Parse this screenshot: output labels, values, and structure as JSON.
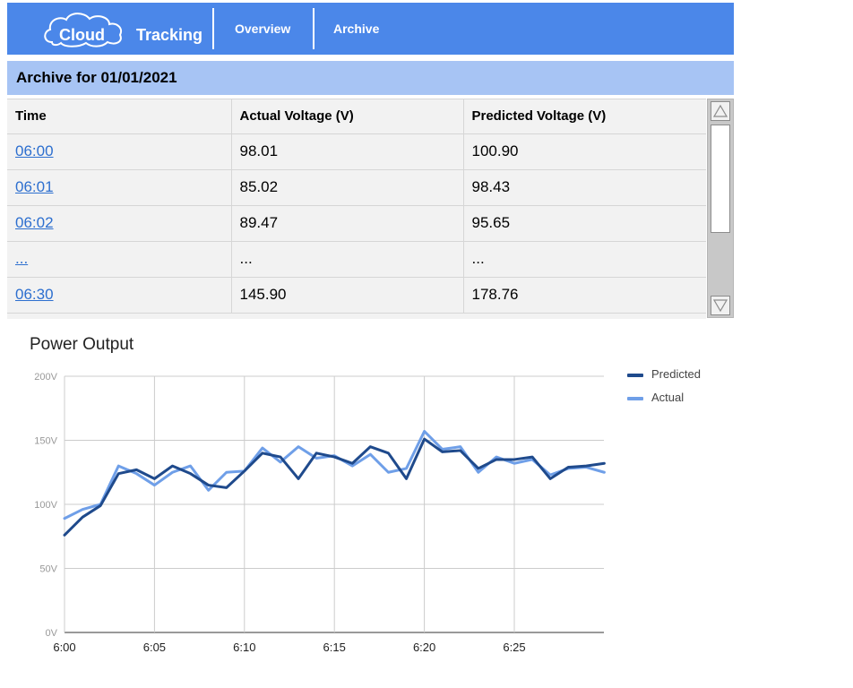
{
  "nav": {
    "logo_word_1": "Cloud",
    "logo_word_2": "Tracking",
    "links": [
      "Overview",
      "Archive"
    ]
  },
  "archive": {
    "title": "Archive for 01/01/2021"
  },
  "table": {
    "headers": [
      "Time",
      "Actual Voltage (V)",
      "Predicted Voltage (V)"
    ],
    "rows": [
      [
        "06:00",
        "98.01",
        "100.90"
      ],
      [
        "06:01",
        "85.02",
        "98.43"
      ],
      [
        "06:02",
        "89.47",
        "95.65"
      ],
      [
        "...",
        "...",
        "..."
      ],
      [
        "06:30",
        "145.90",
        "178.76"
      ]
    ]
  },
  "colors": {
    "nav": "#4b87e9",
    "header": "#a7c4f4",
    "predicted": "#1f4a8c",
    "actual": "#6f9fe8",
    "link": "#2d6fcf"
  },
  "chart_data": {
    "type": "line",
    "title": "Power Output",
    "xlabel": "",
    "ylabel": "",
    "x_ticks": [
      "6:00",
      "6:05",
      "6:10",
      "6:15",
      "6:20",
      "6:25"
    ],
    "y_ticks": [
      "0V",
      "50V",
      "100V",
      "150V",
      "200V"
    ],
    "ylim": [
      0,
      200
    ],
    "x": [
      0,
      1,
      2,
      3,
      4,
      5,
      6,
      7,
      8,
      9,
      10,
      11,
      12,
      13,
      14,
      15,
      16,
      17,
      18,
      19,
      20,
      21,
      22,
      23,
      24,
      25,
      26,
      27,
      28,
      29,
      30
    ],
    "series": [
      {
        "name": "Predicted",
        "values": [
          76,
          90,
          99,
          124,
          127,
          120,
          130,
          124,
          115,
          113,
          126,
          140,
          137,
          120,
          140,
          137,
          132,
          145,
          140,
          120,
          151,
          141,
          142,
          128,
          135,
          135,
          137,
          120,
          129,
          130,
          132
        ]
      },
      {
        "name": "Actual",
        "values": [
          89,
          96,
          100,
          130,
          124,
          115,
          125,
          130,
          111,
          125,
          126,
          144,
          133,
          145,
          136,
          138,
          130,
          139,
          125,
          128,
          157,
          143,
          145,
          125,
          137,
          132,
          135,
          123,
          128,
          129,
          125
        ]
      }
    ],
    "grid": true,
    "legend": "top-right"
  }
}
